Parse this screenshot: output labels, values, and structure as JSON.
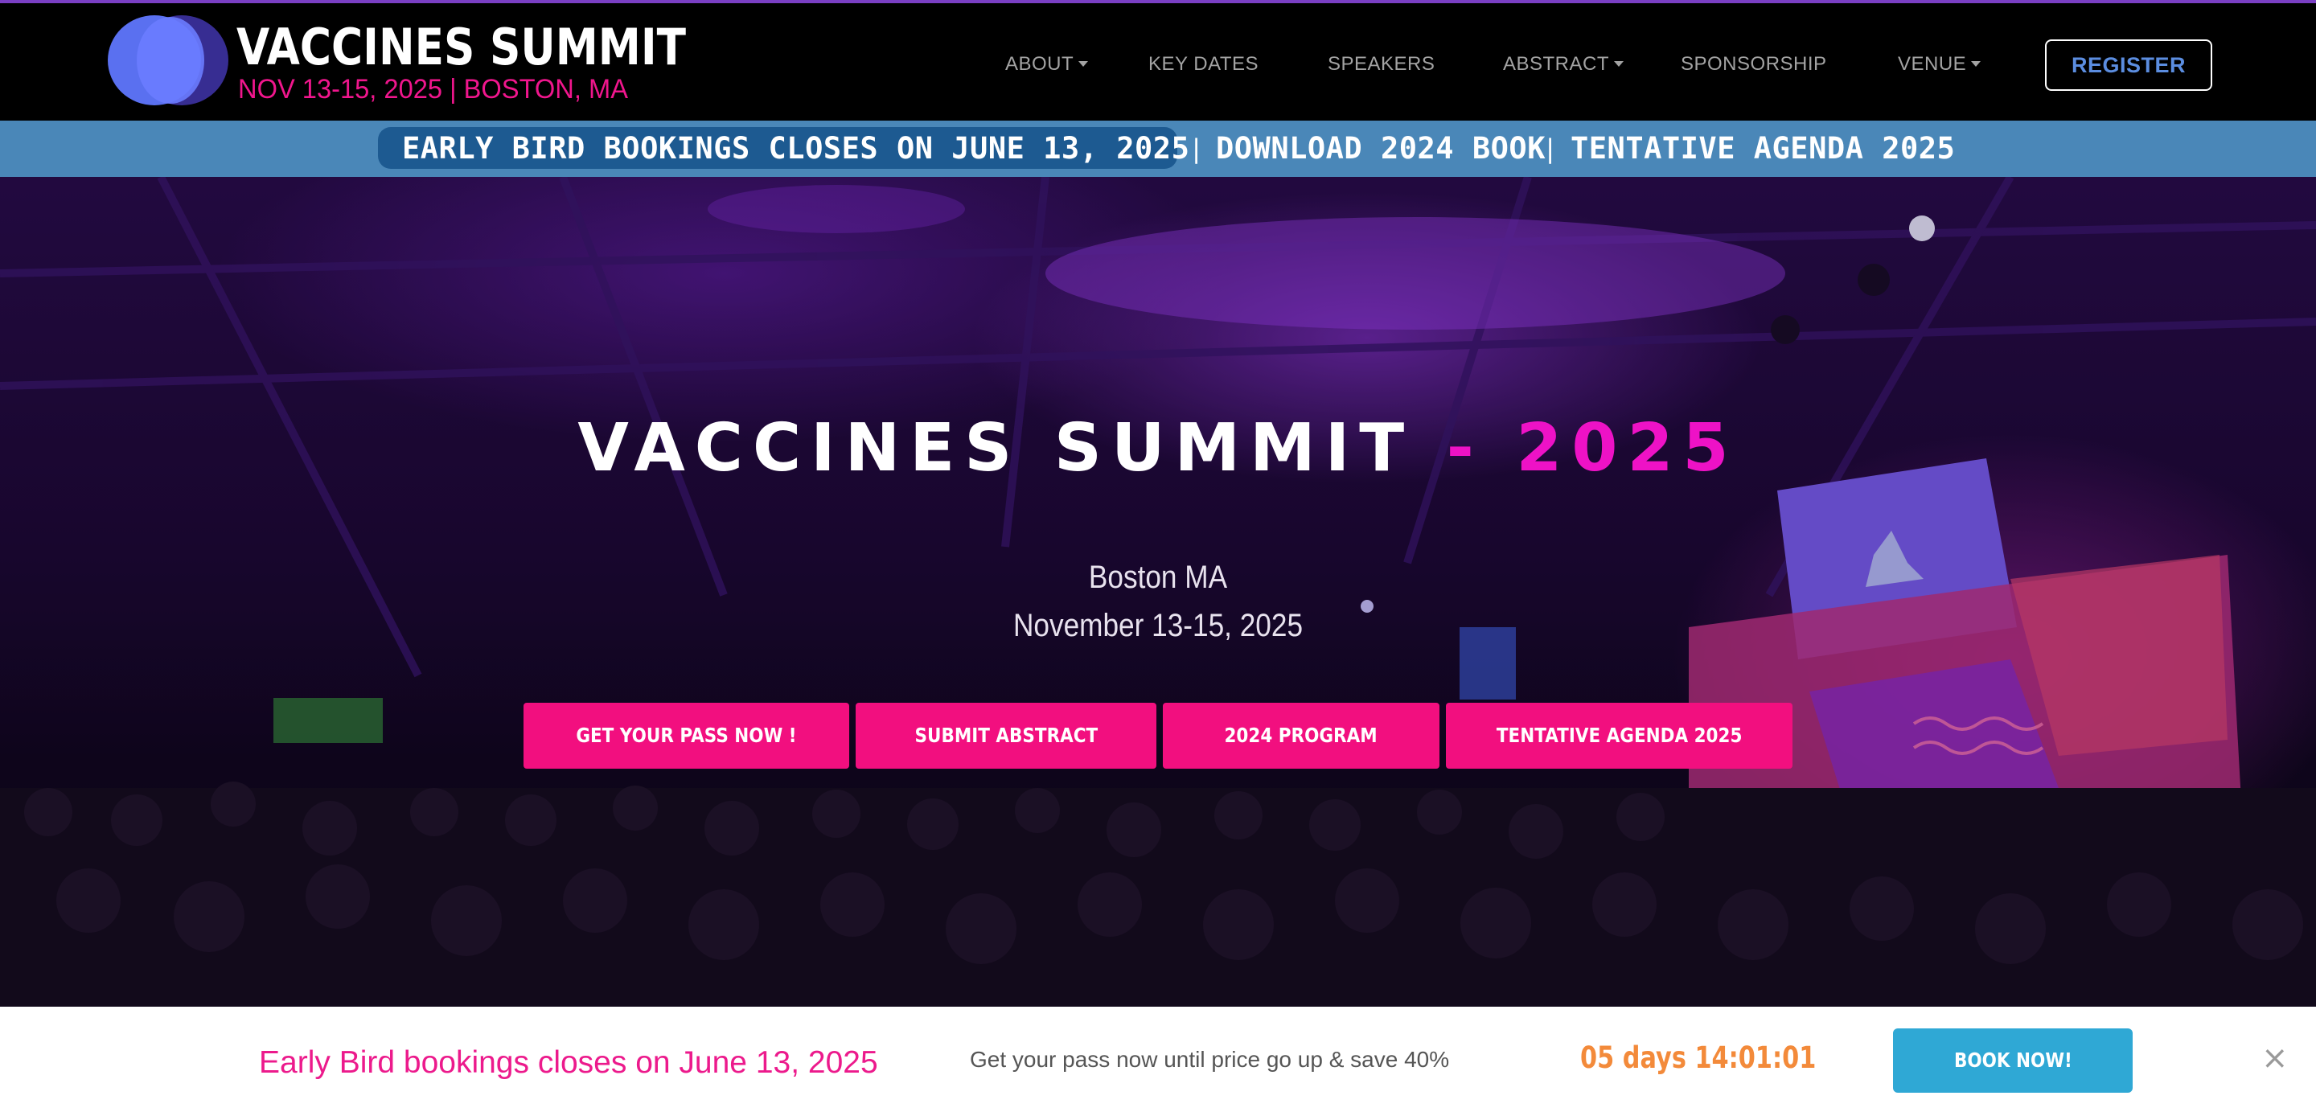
{
  "colors": {
    "accent_pink": "#f20f7f",
    "title_magenta": "#ee12c6",
    "announce_bar": "#4a87b8",
    "announce_pill": "#1d5a91",
    "register_text": "#5b8de0",
    "countdown_orange": "#f38a3a",
    "book_button": "#2fa8d5"
  },
  "logo": {
    "title": "VACCINES SUMMIT",
    "subtitle": "NOV 13-15, 2025 | BOSTON, MA"
  },
  "nav": {
    "items": [
      {
        "label": "ABOUT",
        "dropdown": true
      },
      {
        "label": "KEY DATES",
        "dropdown": false
      },
      {
        "label": "SPEAKERS",
        "dropdown": false
      },
      {
        "label": "ABSTRACT",
        "dropdown": true
      },
      {
        "label": "SPONSORSHIP",
        "dropdown": false
      },
      {
        "label": "VENUE",
        "dropdown": true
      }
    ],
    "register_label": "REGISTER"
  },
  "announcement": {
    "early_bird": "EARLY BIRD BOOKINGS CLOSES ON JUNE 13, 2025",
    "separator": "|",
    "download": "DOWNLOAD 2024 BOOK",
    "agenda": "TENTATIVE AGENDA 2025"
  },
  "hero": {
    "title_main": "VACCINES SUMMIT",
    "title_year": "- 2025",
    "location": "Boston MA",
    "dates": "November 13-15, 2025",
    "buttons": [
      "GET YOUR PASS NOW !",
      "SUBMIT ABSTRACT",
      "2024 PROGRAM",
      "TENTATIVE AGENDA 2025"
    ]
  },
  "bottom_bar": {
    "early_bird": "Early Bird bookings closes on June 13, 2025",
    "pass_text": "Get your pass now until price go up & save 40%",
    "countdown": "05 days 14:01:01",
    "book_label": "BOOK NOW!",
    "close_icon": "close-icon"
  }
}
